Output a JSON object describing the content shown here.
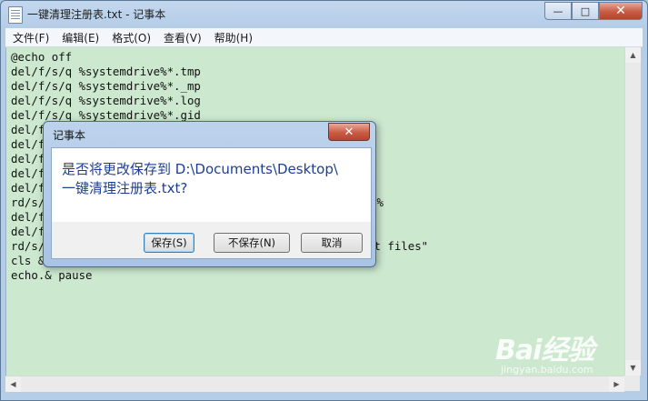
{
  "window": {
    "title": "一键清理注册表.txt - 记事本",
    "buttons": {
      "minimize": "—",
      "maximize": "□",
      "close": "✕"
    }
  },
  "menu": [
    "文件(F)",
    "编辑(E)",
    "格式(O)",
    "查看(V)",
    "帮助(H)"
  ],
  "editor": {
    "lines": [
      "@echo off",
      "del/f/s/q %systemdrive%*.tmp",
      "del/f/s/q %systemdrive%*._mp",
      "del/f/s/q %systemdrive%*.log",
      "del/f/s/q %systemdrive%*.gid",
      "del/f",
      "del/f",
      "del/f",
      "del/f",
      "del/f",
      "rd/s/",
      "del/f",
      "del/f",
      "rd/s/",
      "cls &",
      "echo.& pause"
    ],
    "line_tails": {
      "10": "p%",
      "13": "et files\""
    }
  },
  "dialog": {
    "title": "记事本",
    "close": "✕",
    "message_line1": "是否将更改保存到 D:\\Documents\\Desktop\\",
    "message_line2": "一键清理注册表.txt?",
    "buttons": {
      "save": "保存(S)",
      "dont_save": "不保存(N)",
      "cancel": "取消"
    }
  },
  "watermark": {
    "brand": "Bai经验",
    "sub": "jingyan.baidu.com"
  },
  "colors": {
    "editor_bg": "#cce8cf",
    "dialog_text": "#1c3f94",
    "close_btn": "#c85c45"
  }
}
